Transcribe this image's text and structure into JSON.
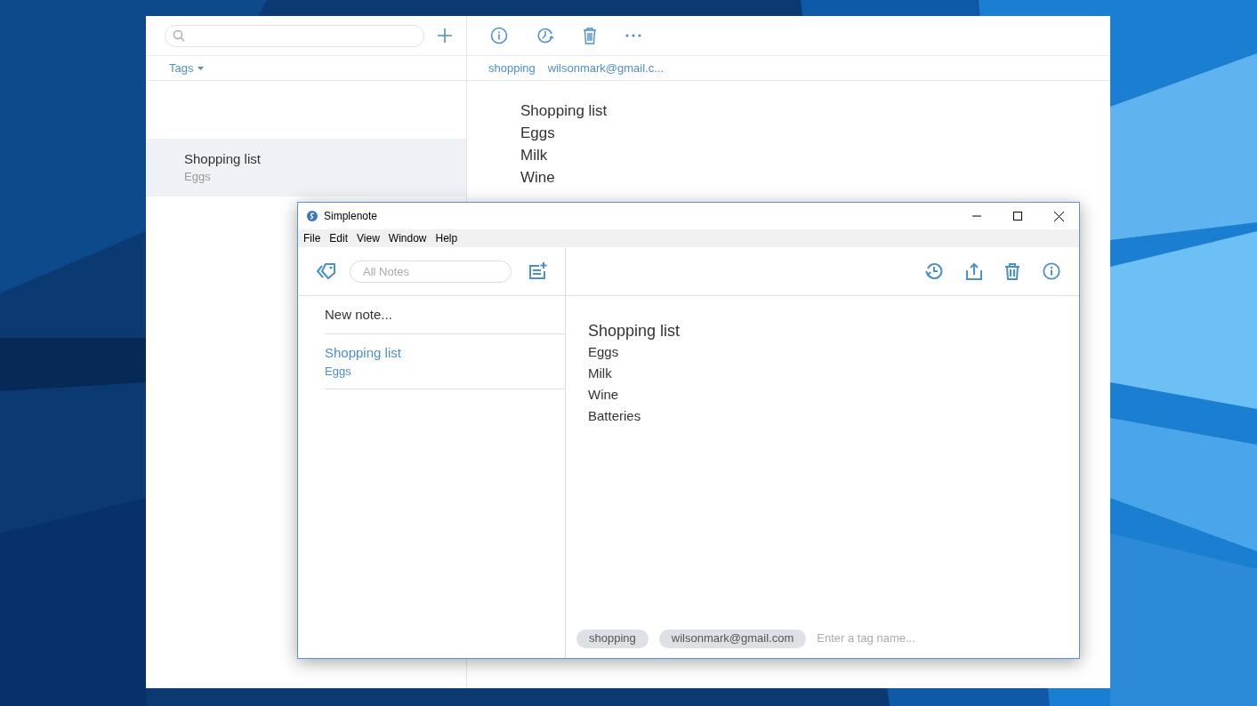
{
  "back_window": {
    "tags_menu": "Tags",
    "tag_links": [
      "shopping",
      "wilsonmark@gmail.c..."
    ],
    "notes": [
      {
        "title": "Shopping list",
        "preview": "Eggs",
        "selected": true
      }
    ],
    "content_lines": [
      "Shopping list",
      "Eggs",
      "Milk",
      "Wine"
    ]
  },
  "front_window": {
    "title": "Simplenote",
    "menu": [
      "File",
      "Edit",
      "View",
      "Window",
      "Help"
    ],
    "search": {
      "placeholder": "All Notes"
    },
    "new_note": "New note...",
    "notes": [
      {
        "title": "Shopping list",
        "preview": "Eggs",
        "selected": true
      }
    ],
    "editor": {
      "title": "Shopping list",
      "lines": [
        "Eggs",
        "Milk",
        "Wine",
        "Batteries"
      ]
    },
    "tags": [
      "shopping",
      "wilsonmark@gmail.com"
    ],
    "tag_input": {
      "placeholder": "Enter a tag name..."
    }
  }
}
